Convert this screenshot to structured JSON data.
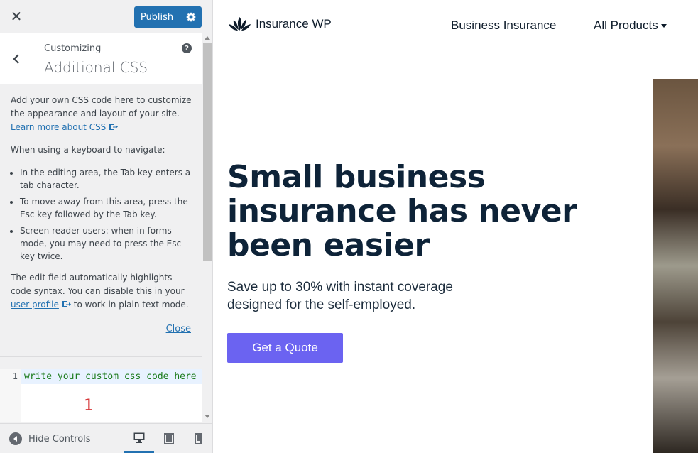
{
  "sidebar": {
    "publish_label": "Publish",
    "customizing_label": "Customizing",
    "panel_title": "Additional CSS",
    "help_glyph": "?",
    "description": {
      "intro": "Add your own CSS code here to customize the appearance and layout of your site.",
      "learn_more": "Learn more about CSS",
      "keyboard_heading": "When using a keyboard to navigate:",
      "tips": [
        "In the editing area, the Tab key enters a tab character.",
        "To move away from this area, press the Esc key followed by the Tab key.",
        "Screen reader users: when in forms mode, you may need to press the Esc key twice."
      ],
      "highlight_text_before": "The edit field automatically highlights code syntax. You can disable this in your",
      "user_profile_link": "user profile",
      "highlight_text_after": "to work in plain text mode.",
      "close_label": "Close"
    },
    "editor": {
      "line_number": "1",
      "code": "write your custom css code here",
      "annotation": "1"
    },
    "footer": {
      "hide_controls_label": "Hide Controls"
    },
    "icons": {
      "close": "close-icon",
      "back": "chevron-left-icon",
      "settings": "gear-icon",
      "external": "external-link-icon",
      "desktop": "desktop-icon",
      "tablet": "tablet-icon",
      "mobile": "mobile-icon"
    }
  },
  "preview": {
    "site_name": "Insurance WP",
    "nav": {
      "business": "Business Insurance",
      "products": "All Products"
    },
    "hero": {
      "title": "Small business insurance has never been easier",
      "subtitle": "Save up to 30% with instant coverage designed for the self-employed.",
      "cta": "Get a Quote"
    }
  },
  "colors": {
    "wp_blue": "#2271b1",
    "cta": "#6b63f1",
    "heading": "#0e2338",
    "annotation": "#d63638"
  }
}
